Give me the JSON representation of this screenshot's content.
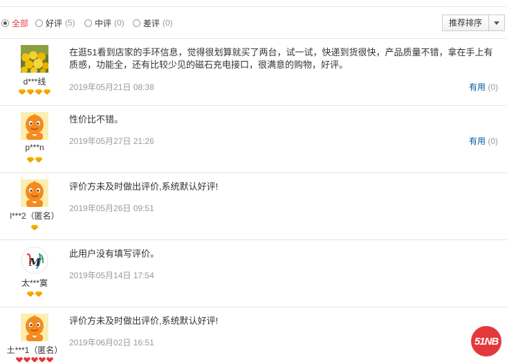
{
  "filters": [
    {
      "label": "全部",
      "count": "",
      "checked": true
    },
    {
      "label": "好评",
      "count": "(5)",
      "checked": false
    },
    {
      "label": "中评",
      "count": "(0)",
      "checked": false
    },
    {
      "label": "差评",
      "count": "(0)",
      "checked": false
    }
  ],
  "sort": {
    "label": "推荐排序"
  },
  "reviews": [
    {
      "user": "d***线",
      "content": "在逛51看到店家的手环信息，觉得很划算就买了两台，试一试，快递到货很快，产品质量不错，拿在手上有质感，功能全，还有比较少见的磁石充电接口，很满意的购物，好评。",
      "date": "2019年05月21日 08:38",
      "useful_label": "有用",
      "useful_count": "(0)",
      "rank_icon": "diamond",
      "rank_count": 4
    },
    {
      "user": "p***n",
      "content": "性价比不错。",
      "date": "2019年05月27日 21:26",
      "useful_label": "有用",
      "useful_count": "(0)",
      "rank_icon": "diamond",
      "rank_count": 2
    },
    {
      "user": "l***2（匿名）",
      "content": "评价方未及时做出评价,系统默认好评!",
      "date": "2019年05月26日 09:51",
      "useful_label": "",
      "useful_count": "",
      "rank_icon": "diamond",
      "rank_count": 1
    },
    {
      "user": "太***寞",
      "content": "此用户没有填写评价。",
      "date": "2019年05月14日 17:54",
      "useful_label": "",
      "useful_count": "",
      "rank_icon": "diamond",
      "rank_count": 2
    },
    {
      "user": "土***1（匿名）",
      "content": "评价方未及时做出评价,系统默认好评!",
      "date": "2019年06月02日 16:51",
      "useful_label": "",
      "useful_count": "",
      "rank_icon": "heart",
      "rank_count": 5
    }
  ],
  "logo": {
    "text": "51NB"
  },
  "colors": {
    "accent": "#e4393c",
    "link": "#005aa0",
    "muted": "#999999",
    "gem": "#f0a000"
  }
}
